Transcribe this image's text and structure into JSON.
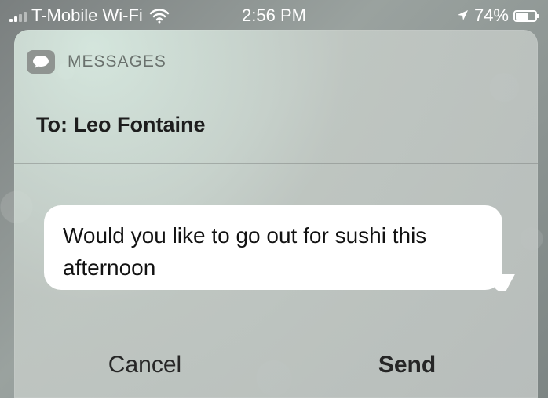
{
  "status_bar": {
    "carrier": "T-Mobile Wi-Fi",
    "time": "2:56 PM",
    "battery": "74%",
    "battery_level": 0.74,
    "icons": {
      "signal": "signal-bars-icon",
      "wifi": "wifi-icon",
      "location": "location-arrow-icon",
      "battery": "battery-icon"
    }
  },
  "notification": {
    "app_name": "MESSAGES",
    "app_icon": "messages-app-icon",
    "recipient": "To: Leo Fontaine",
    "message": "Would you like to go out for sushi this afternoon",
    "buttons": {
      "cancel": "Cancel",
      "send": "Send"
    }
  }
}
